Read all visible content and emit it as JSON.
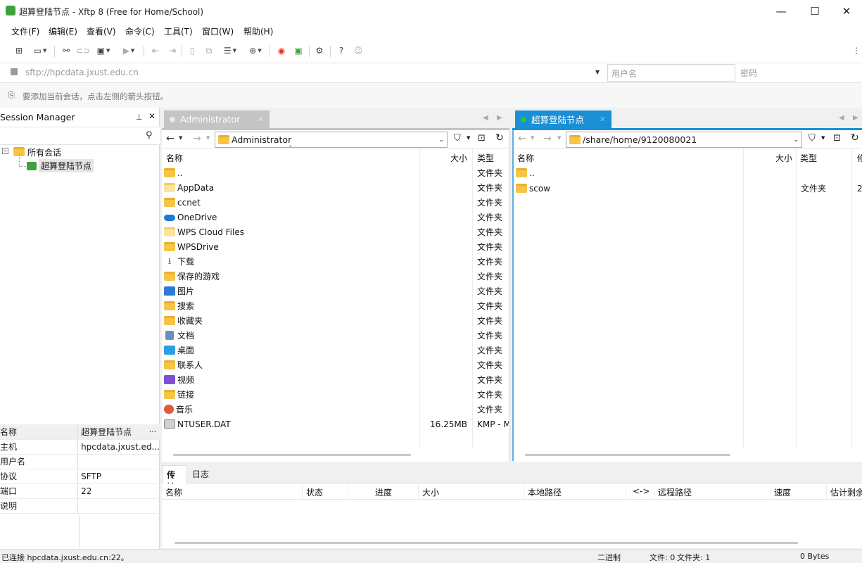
{
  "window": {
    "title": "超算登陆节点 - Xftp 8 (Free for Home/School)",
    "minimize": "—",
    "maximize": "☐",
    "close": "✕"
  },
  "menu": [
    "文件(F)",
    "编辑(E)",
    "查看(V)",
    "命令(C)",
    "工具(T)",
    "窗口(W)",
    "帮助(H)"
  ],
  "address": {
    "url": "sftp://hpcdata.jxust.edu.cn",
    "user_placeholder": "用户名",
    "password_placeholder": "密码"
  },
  "hint": "要添加当前会话，点击左侧的箭头按钮。",
  "session_manager": {
    "title": "Session Manager",
    "tree": [
      {
        "label": "所有会话"
      },
      {
        "label": "超算登陆节点"
      }
    ],
    "props": [
      {
        "k": "名称",
        "v": "超算登陆节点"
      },
      {
        "k": "主机",
        "v": "hpcdata.jxust.ed..."
      },
      {
        "k": "用户名",
        "v": ""
      },
      {
        "k": "协议",
        "v": "SFTP"
      },
      {
        "k": "端口",
        "v": "22"
      },
      {
        "k": "说明",
        "v": ""
      }
    ],
    "more": "..."
  },
  "local": {
    "tab": "Administrator",
    "path": "Administrator",
    "headers": {
      "name": "名称",
      "size": "大小",
      "type": "类型"
    },
    "files": [
      {
        "name": "..",
        "size": "",
        "type": "文件夹",
        "icon": "folder"
      },
      {
        "name": "AppData",
        "size": "",
        "type": "文件夹",
        "icon": "folder-hidden"
      },
      {
        "name": "ccnet",
        "size": "",
        "type": "文件夹",
        "icon": "folder"
      },
      {
        "name": "OneDrive",
        "size": "",
        "type": "文件夹",
        "icon": "onedrive"
      },
      {
        "name": "WPS Cloud Files",
        "size": "",
        "type": "文件夹",
        "icon": "folder-hidden"
      },
      {
        "name": "WPSDrive",
        "size": "",
        "type": "文件夹",
        "icon": "folder"
      },
      {
        "name": "下载",
        "size": "",
        "type": "文件夹",
        "icon": "download"
      },
      {
        "name": "保存的游戏",
        "size": "",
        "type": "文件夹",
        "icon": "folder"
      },
      {
        "name": "图片",
        "size": "",
        "type": "文件夹",
        "icon": "pictures"
      },
      {
        "name": "搜索",
        "size": "",
        "type": "文件夹",
        "icon": "folder"
      },
      {
        "name": "收藏夹",
        "size": "",
        "type": "文件夹",
        "icon": "folder"
      },
      {
        "name": "文档",
        "size": "",
        "type": "文件夹",
        "icon": "documents"
      },
      {
        "name": "桌面",
        "size": "",
        "type": "文件夹",
        "icon": "desktop"
      },
      {
        "name": "联系人",
        "size": "",
        "type": "文件夹",
        "icon": "folder"
      },
      {
        "name": "视频",
        "size": "",
        "type": "文件夹",
        "icon": "videos"
      },
      {
        "name": "链接",
        "size": "",
        "type": "文件夹",
        "icon": "folder"
      },
      {
        "name": "音乐",
        "size": "",
        "type": "文件夹",
        "icon": "music"
      },
      {
        "name": "NTUSER.DAT",
        "size": "16.25MB",
        "type": "KMP - M",
        "icon": "dat-file"
      }
    ]
  },
  "remote": {
    "tab": "超算登陆节点",
    "path": "/share/home/9120080021",
    "headers": {
      "name": "名称",
      "size": "大小",
      "type": "类型",
      "extra": "修"
    },
    "files": [
      {
        "name": "..",
        "size": "",
        "type": "",
        "extra": ""
      },
      {
        "name": "scow",
        "size": "",
        "type": "文件夹",
        "extra": "2"
      }
    ]
  },
  "bottom_tabs": [
    "传输",
    "日志"
  ],
  "transfer_headers": [
    "名称",
    "状态",
    "进度",
    "大小",
    "本地路径",
    "<->",
    "远程路径",
    "速度",
    "估计剩余"
  ],
  "status": {
    "left": "已连接 hpcdata.jxust.edu.cn:22。",
    "mode": "二进制",
    "files": "文件: 0",
    "folders": "文件夹: 1",
    "bytes": "0 Bytes"
  },
  "colors": {
    "accent": "#1a8fd6",
    "connected": "#2fc52f",
    "inactive_tab": "#c4c4c4"
  }
}
